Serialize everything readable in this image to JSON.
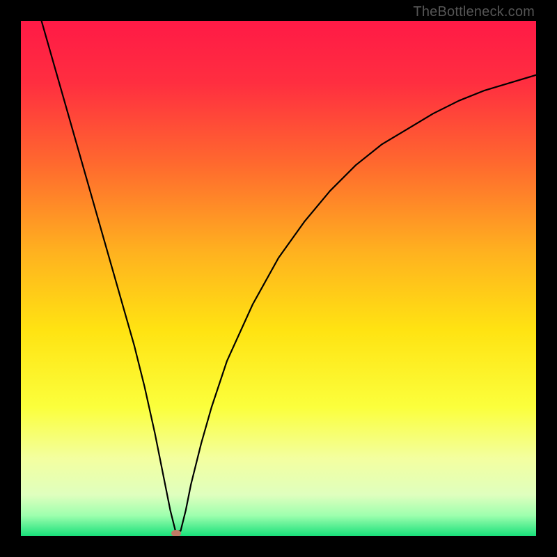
{
  "attribution": "TheBottleneck.com",
  "chart_data": {
    "type": "line",
    "title": "",
    "xlabel": "",
    "ylabel": "",
    "xlim": [
      0,
      100
    ],
    "ylim": [
      0,
      100
    ],
    "series": [
      {
        "name": "bottleneck-curve",
        "x": [
          4,
          6,
          8,
          10,
          12,
          14,
          16,
          18,
          20,
          22,
          24,
          26,
          27,
          28,
          29,
          30,
          31,
          32,
          33,
          35,
          37,
          40,
          45,
          50,
          55,
          60,
          65,
          70,
          75,
          80,
          85,
          90,
          95,
          100
        ],
        "values": [
          100,
          93,
          86,
          79,
          72,
          65,
          58,
          51,
          44,
          37,
          29,
          20,
          15,
          10,
          5,
          1,
          1,
          5,
          10,
          18,
          25,
          34,
          45,
          54,
          61,
          67,
          72,
          76,
          79,
          82,
          84.5,
          86.5,
          88,
          89.5
        ]
      }
    ],
    "marker": {
      "x": 30.2,
      "y": 0.6,
      "color": "#c07a66"
    },
    "gradient_stops": [
      {
        "offset": 0,
        "color": "#ff1a46"
      },
      {
        "offset": 12,
        "color": "#ff2e40"
      },
      {
        "offset": 28,
        "color": "#ff6a2e"
      },
      {
        "offset": 45,
        "color": "#ffb21f"
      },
      {
        "offset": 60,
        "color": "#ffe312"
      },
      {
        "offset": 75,
        "color": "#fbff3c"
      },
      {
        "offset": 85,
        "color": "#f3ffa0"
      },
      {
        "offset": 92,
        "color": "#dfffbe"
      },
      {
        "offset": 96,
        "color": "#9effae"
      },
      {
        "offset": 100,
        "color": "#18e07a"
      }
    ]
  }
}
